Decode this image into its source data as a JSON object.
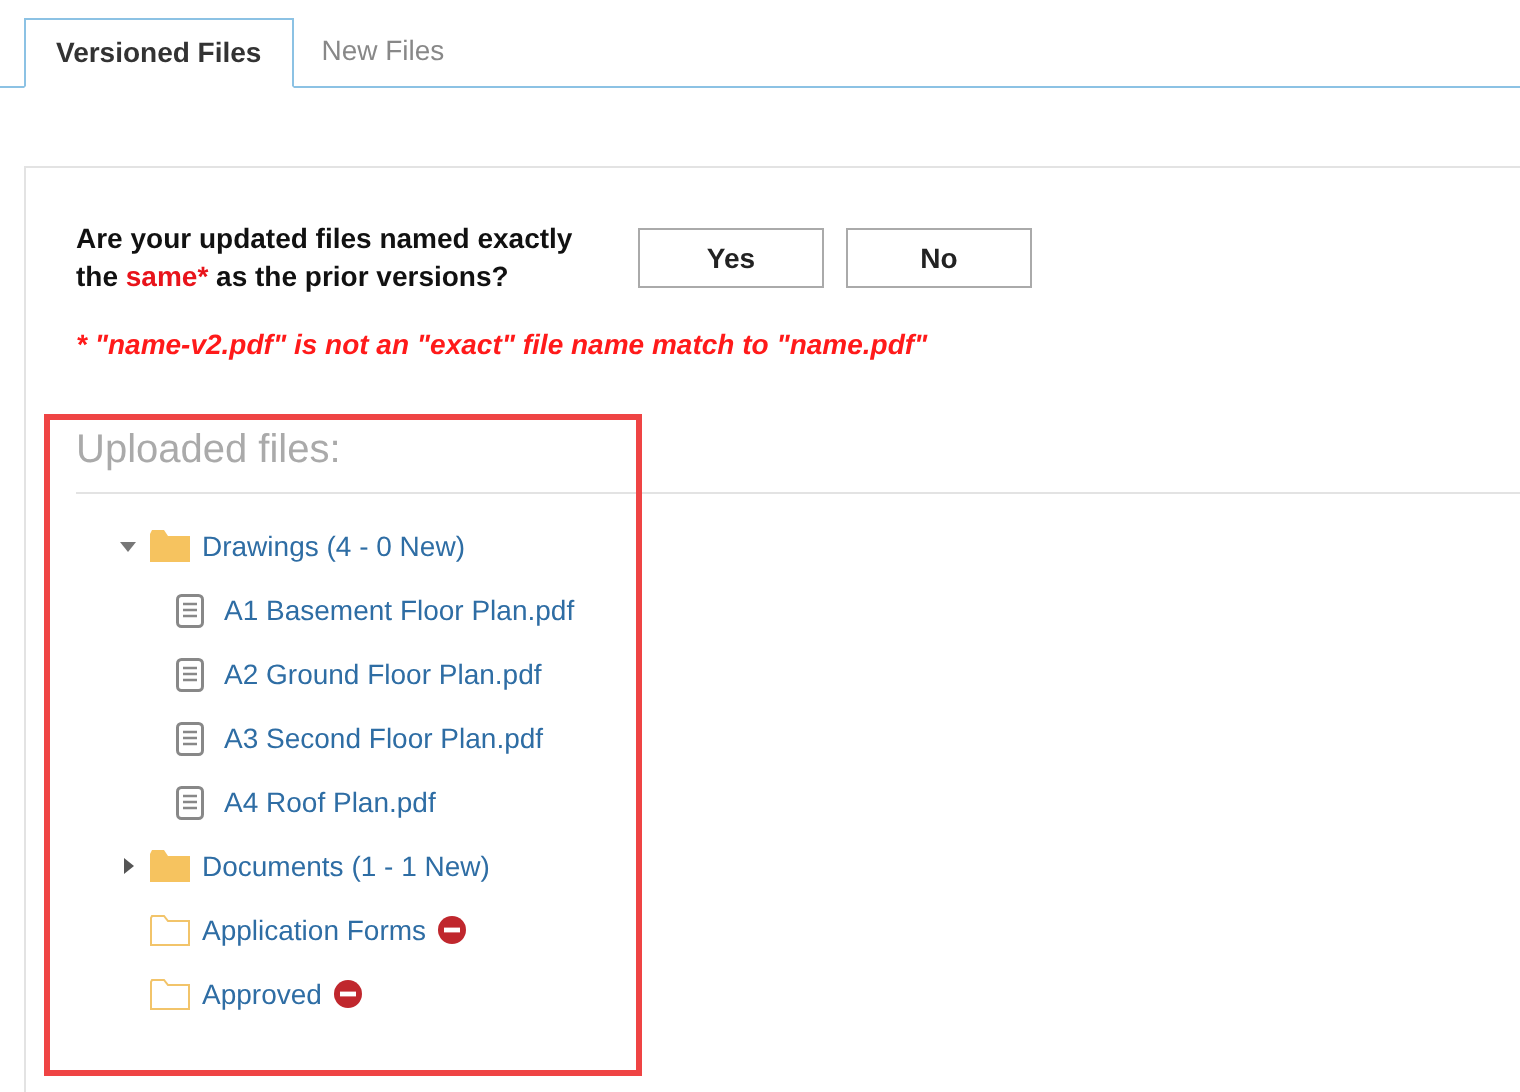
{
  "tabs": [
    {
      "label": "Versioned Files",
      "selected": true
    },
    {
      "label": "New Files",
      "selected": false
    }
  ],
  "question": {
    "before": "Are your updated files named exactly the ",
    "highlight": "same*",
    "after": " as the prior versions?"
  },
  "buttons": [
    "Yes",
    "No"
  ],
  "note": "* \"name-v2.pdf\" is not an \"exact\" file name match to \"name.pdf\"",
  "uploaded_heading": "Uploaded files:",
  "tree": [
    {
      "kind": "folder",
      "label": "Drawings (4 - 0 New)",
      "filled": true,
      "expanded": true,
      "blocked": false,
      "children": [
        {
          "kind": "file",
          "label": "A1 Basement Floor Plan.pdf"
        },
        {
          "kind": "file",
          "label": "A2 Ground Floor Plan.pdf"
        },
        {
          "kind": "file",
          "label": "A3 Second Floor Plan.pdf"
        },
        {
          "kind": "file",
          "label": "A4 Roof Plan.pdf"
        }
      ]
    },
    {
      "kind": "folder",
      "label": "Documents (1 - 1 New)",
      "filled": true,
      "expanded": false,
      "blocked": false,
      "has_children": true
    },
    {
      "kind": "folder",
      "label": "Application Forms",
      "filled": false,
      "expanded": false,
      "blocked": true
    },
    {
      "kind": "folder",
      "label": "Approved",
      "filled": false,
      "expanded": false,
      "blocked": true
    }
  ]
}
